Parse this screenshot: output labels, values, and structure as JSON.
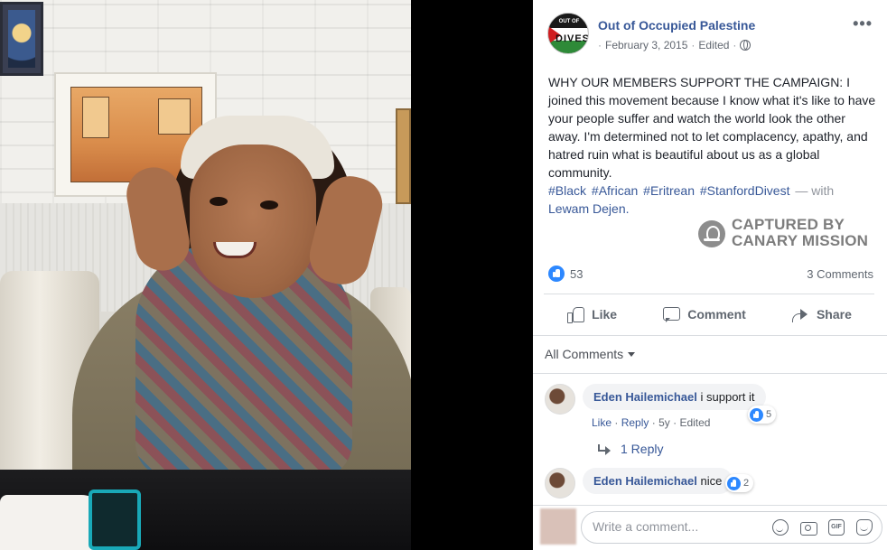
{
  "post": {
    "page_name": "Out of Occupied Palestine",
    "date": "February 3, 2015",
    "edited": "Edited",
    "separator": "·",
    "avatar_top_text": "OUT OF OCCUPIED PALESTINE",
    "avatar_bottom_text": "DIVEST",
    "text": "WHY OUR MEMBERS SUPPORT THE CAMPAIGN: I joined this movement because I know what it's like to have your people suffer and watch the world look the other away. I'm determined not to let complacency, apathy, and hatred ruin what is beautiful about us as a global community.",
    "hashtags": [
      "#Black",
      "#African",
      "#Eritrean",
      "#StanfordDivest"
    ],
    "with_text": "— with",
    "tagged_person": "Lewam Dejen."
  },
  "watermark": {
    "line1": "CAPTURED BY",
    "line2": "CANARY MISSION"
  },
  "stats": {
    "reactions": "53",
    "comments": "3 Comments"
  },
  "actions": {
    "like": "Like",
    "comment": "Comment",
    "share": "Share"
  },
  "comments_filter": "All Comments",
  "comments": [
    {
      "name": "Eden Hailemichael",
      "text": "i support it",
      "likes": "5",
      "links": {
        "like": "Like",
        "reply": "Reply",
        "age": "5y",
        "edited": "Edited"
      }
    },
    {
      "name": "Eden Hailemichael",
      "text": "nice",
      "likes": "2"
    }
  ],
  "reply_link": "1 Reply",
  "composer": {
    "placeholder": "Write a comment..."
  },
  "colors": {
    "link_blue": "#385898",
    "like_blue": "#2d88ff",
    "muted_gray": "#606770",
    "watermark_gray": "#7d7d7d"
  },
  "icons": [
    "globe-icon",
    "more-icon",
    "like-icon",
    "comment-icon",
    "share-icon",
    "reply-arrow-icon",
    "emoji-icon",
    "camera-icon",
    "gif-icon",
    "sticker-icon"
  ]
}
